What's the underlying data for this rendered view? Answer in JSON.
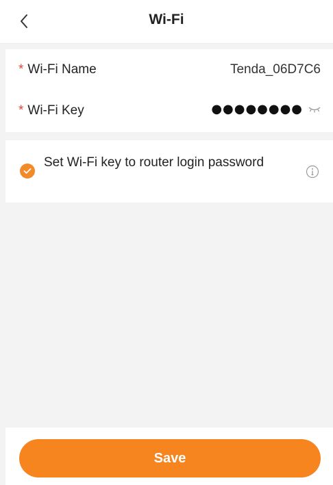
{
  "header": {
    "title": "Wi-Fi",
    "back_icon": "chevron-left-icon"
  },
  "fields": {
    "required_mark": "*",
    "wifi_name": {
      "label": "Wi-Fi Name",
      "value": "Tenda_06D7C6"
    },
    "wifi_key": {
      "label": "Wi-Fi Key",
      "masked_value": "●●●●●●●●",
      "visibility_icon": "eye-closed-icon"
    }
  },
  "option": {
    "label": "Set Wi-Fi key to router login password",
    "checked": true,
    "info_icon": "info-icon"
  },
  "footer": {
    "save_label": "Save"
  },
  "colors": {
    "accent": "#f6841f",
    "required": "#e2453c",
    "background": "#f3f3f3"
  }
}
